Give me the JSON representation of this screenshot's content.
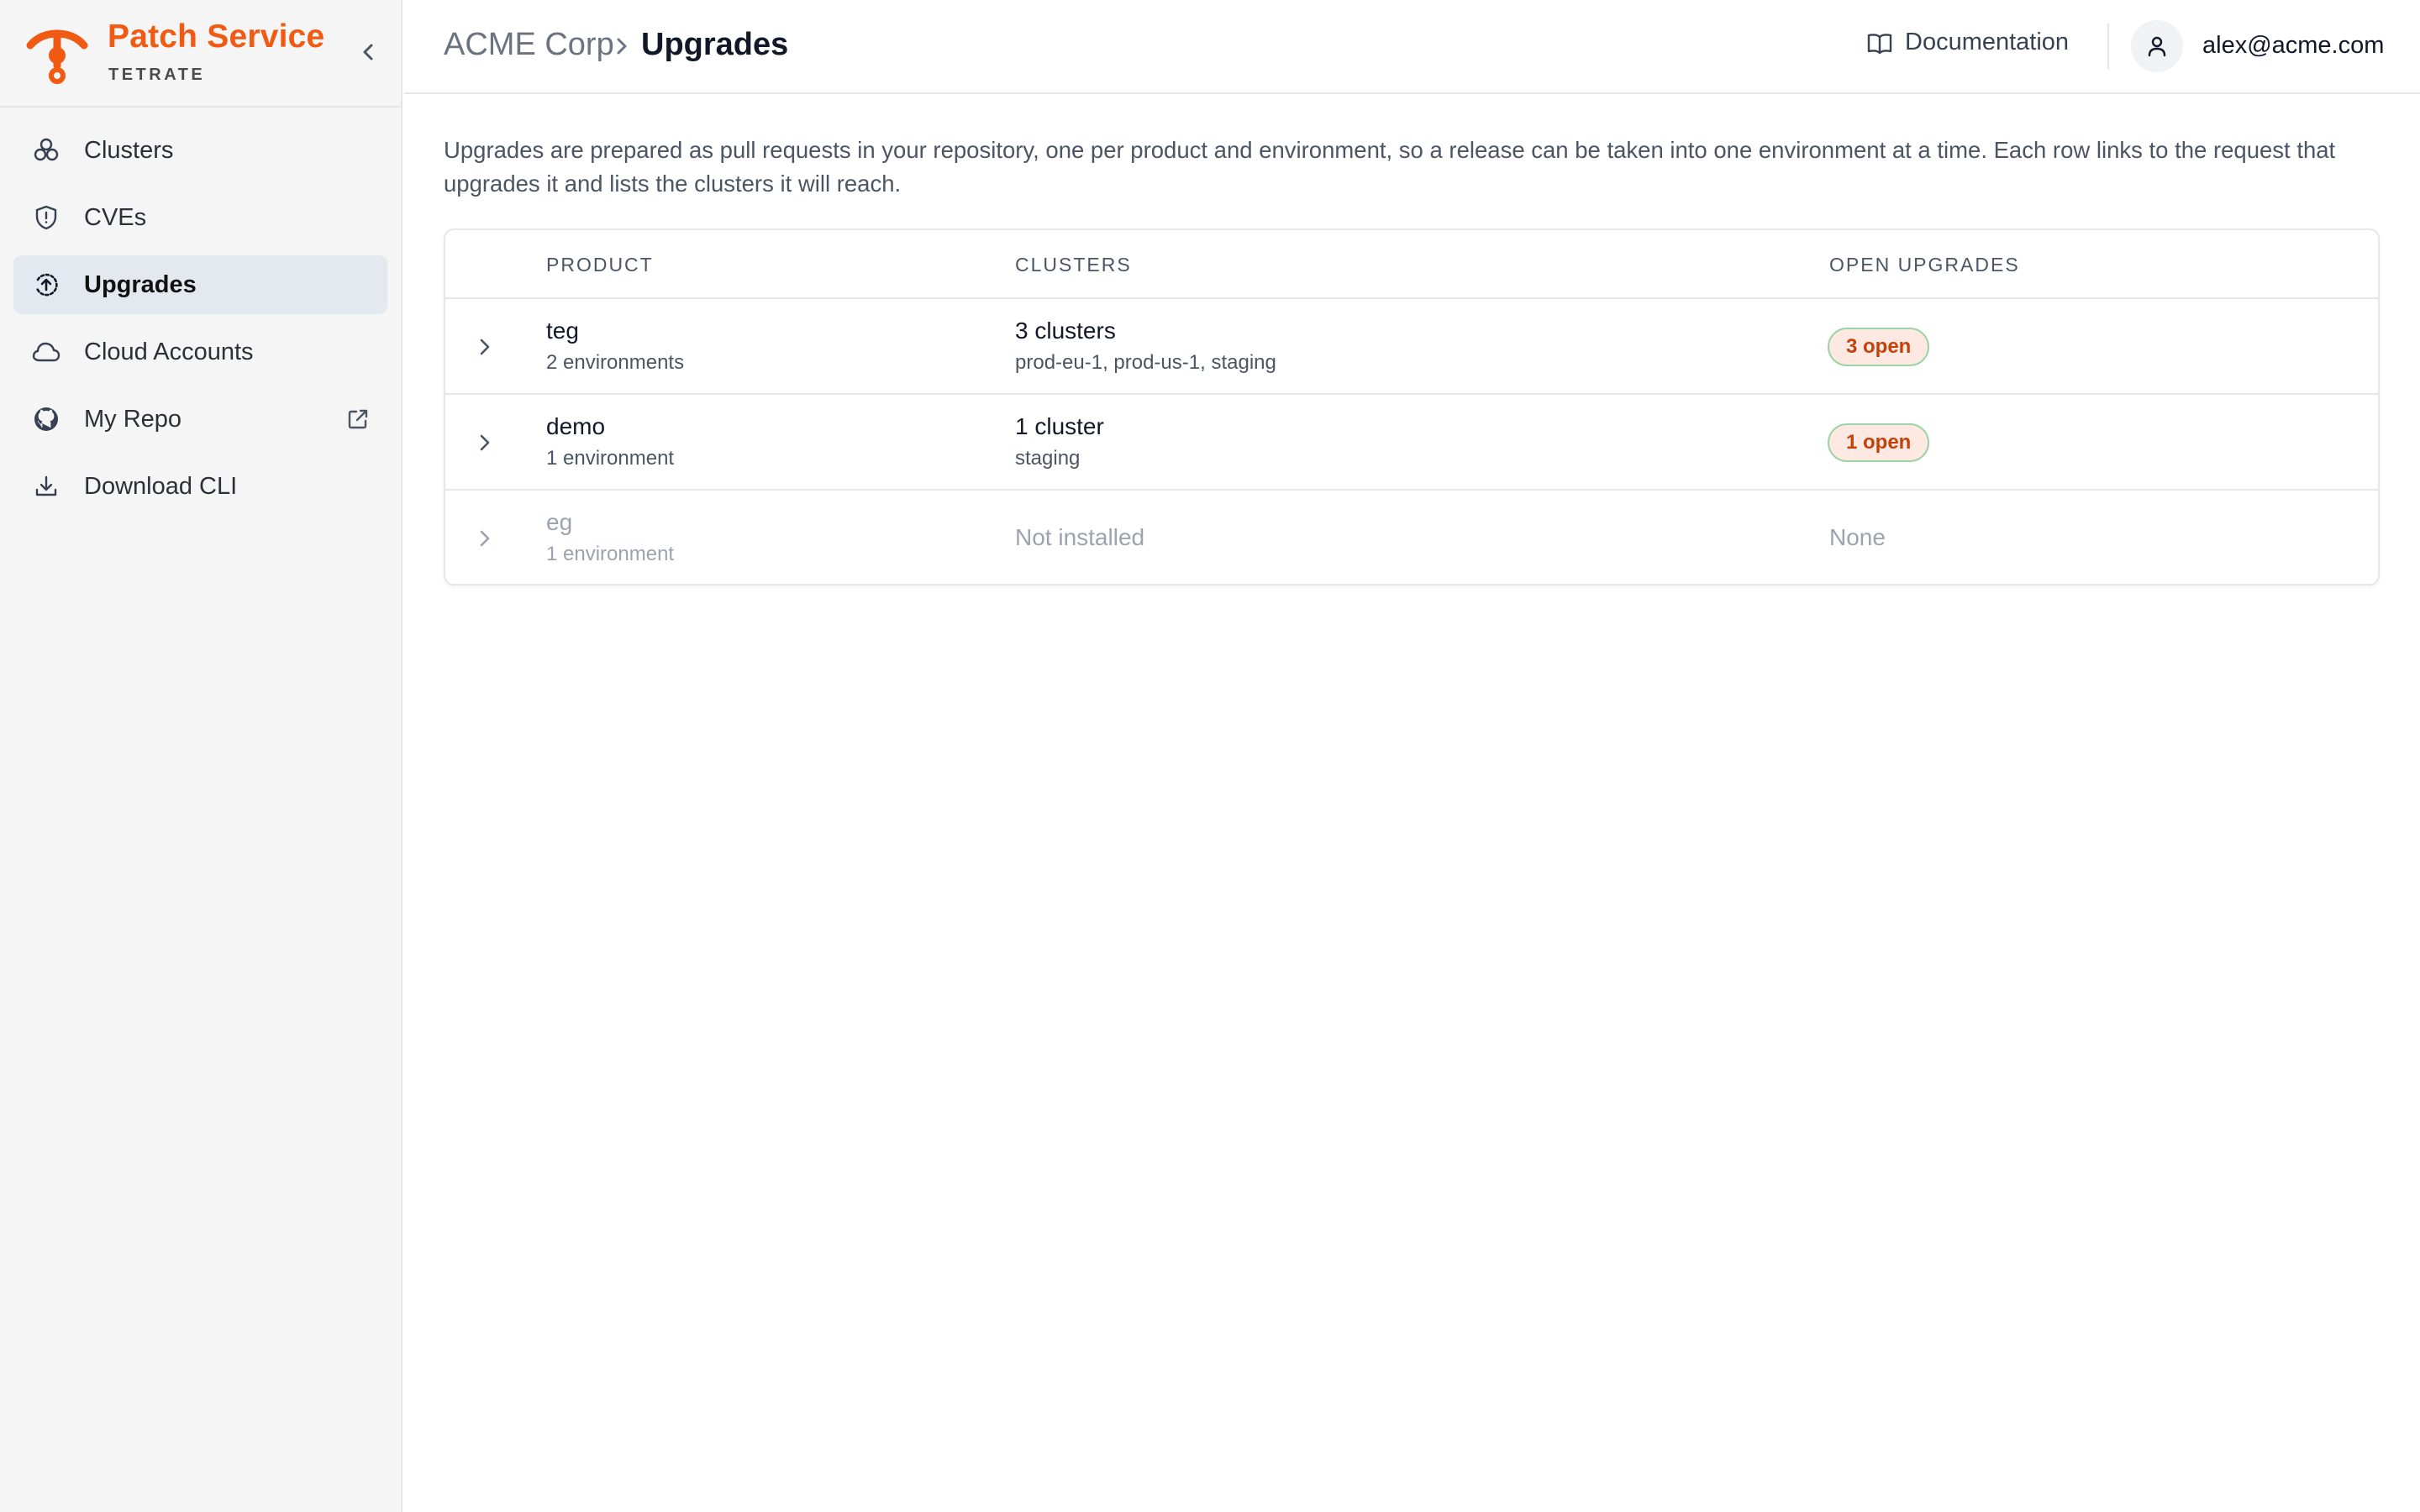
{
  "brand": {
    "title": "Patch Service",
    "subtitle": "TETRATE",
    "accent": "#f05a12"
  },
  "sidebar": {
    "items": [
      {
        "label": "Clusters",
        "icon": "clusters-icon"
      },
      {
        "label": "CVEs",
        "icon": "shield-icon"
      },
      {
        "label": "Upgrades",
        "icon": "upgrade-icon",
        "active": true
      },
      {
        "label": "Cloud Accounts",
        "icon": "cloud-icon"
      },
      {
        "label": "My Repo",
        "icon": "github-icon",
        "external": true
      },
      {
        "label": "Download CLI",
        "icon": "download-icon"
      }
    ]
  },
  "header": {
    "breadcrumb_root": "ACME Corp",
    "breadcrumb_current": "Upgrades",
    "docs_label": "Documentation",
    "user_email": "alex@acme.com"
  },
  "main": {
    "intro": "Upgrades are prepared as pull requests in your repository, one per product and environment, so a release can be taken into one environment at a time. Each row links to the request that upgrades it and lists the clusters it will reach.",
    "table": {
      "columns": [
        "PRODUCT",
        "CLUSTERS",
        "OPEN UPGRADES"
      ],
      "rows": [
        {
          "product": "teg",
          "environments": "2 environments",
          "clusters": "3 clusters",
          "cluster_names": "prod-eu-1, prod-us-1, staging",
          "open": "3 open"
        },
        {
          "product": "demo",
          "environments": "1 environment",
          "clusters": "1 cluster",
          "cluster_names": "staging",
          "open": "1 open"
        },
        {
          "product": "eg",
          "environments": "1 environment",
          "clusters": "Not installed",
          "open": "None"
        }
      ]
    }
  }
}
